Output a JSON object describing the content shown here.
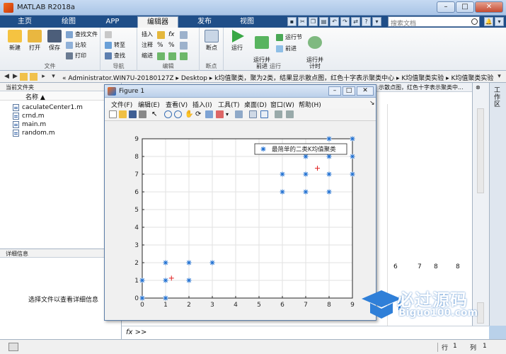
{
  "window": {
    "title": "MATLAB R2018a"
  },
  "tabs": [
    {
      "label": "主页",
      "active": false
    },
    {
      "label": "绘图",
      "active": false
    },
    {
      "label": "APP",
      "active": false
    },
    {
      "label": "编辑器",
      "active": true
    },
    {
      "label": "发布",
      "active": false
    },
    {
      "label": "视图",
      "active": false
    }
  ],
  "search": {
    "placeholder": "搜索文档"
  },
  "ribbon": {
    "file_group": "文件",
    "nav_group": "导航",
    "edit_group": "编辑",
    "bp_group": "断点",
    "run_group": "运行",
    "new": "新建",
    "open": "打开",
    "save": "保存",
    "find_files": "查找文件",
    "compare": "比较",
    "print": "打印",
    "goto": "转至",
    "find": "查找",
    "insert": "插入",
    "comment": "注释",
    "indent": "缩进",
    "breakpoints": "断点",
    "run": "运行",
    "run_advance": "运行并\n前进",
    "run_section": "运行节",
    "advance": "前进",
    "run_time": "运行并\n计时"
  },
  "address": {
    "path": "« Administrator.WIN7U-20180127Z  ▸  Desktop  ▸  k均值聚类，聚为2类，结果显示散点图，红色十字表示聚类中心  ▸  K均值聚类实验  ▸  K均值聚类实验"
  },
  "current_folder": {
    "header": "当前文件夹",
    "col_name": "名称 ▲",
    "files": [
      "caculateCenter1.m",
      "crnd.m",
      "main.m",
      "random.m"
    ]
  },
  "details": {
    "header": "详细信息",
    "hint": "选择文件以查看详细信息"
  },
  "editor": {
    "partial_title": "示散点图，红色十字表示聚类中...",
    "bg_numbers": [
      "6",
      "7",
      "8",
      "8",
      "9"
    ]
  },
  "workspace_label": "工作区",
  "cmd": {
    "prompt": "fx >>"
  },
  "status": {
    "row_label": "行",
    "row": "1",
    "col_label": "列",
    "col": "1"
  },
  "figure": {
    "title": "Figure 1",
    "menu": [
      "文件(F)",
      "编辑(E)",
      "查看(V)",
      "插入(I)",
      "工具(T)",
      "桌面(D)",
      "窗口(W)",
      "帮助(H)"
    ]
  },
  "chart_data": {
    "type": "scatter",
    "title": "",
    "xlabel": "",
    "ylabel": "",
    "xlim": [
      0,
      9
    ],
    "ylim": [
      0,
      9
    ],
    "xticks": [
      0,
      1,
      2,
      3,
      4,
      5,
      6,
      7,
      8,
      9
    ],
    "yticks": [
      0,
      1,
      2,
      3,
      4,
      5,
      6,
      7,
      8,
      9
    ],
    "grid": true,
    "legend": {
      "entries": [
        "最简单的二类K均值聚类"
      ],
      "placement": "top-right"
    },
    "series": [
      {
        "name": "最简单的二类K均值聚类",
        "marker": "*",
        "color": "#1f6fd1",
        "points": [
          [
            0,
            0
          ],
          [
            0,
            1
          ],
          [
            1,
            0
          ],
          [
            1,
            1
          ],
          [
            1,
            2
          ],
          [
            2,
            1
          ],
          [
            2,
            2
          ],
          [
            3,
            2
          ],
          [
            6,
            6
          ],
          [
            6,
            7
          ],
          [
            7,
            6
          ],
          [
            7,
            7
          ],
          [
            7,
            8
          ],
          [
            8,
            6
          ],
          [
            8,
            7
          ],
          [
            8,
            8
          ],
          [
            8,
            9
          ],
          [
            9,
            7
          ],
          [
            9,
            8
          ],
          [
            9,
            9
          ]
        ]
      },
      {
        "name": "",
        "marker": "+",
        "color": "#e02020",
        "points": [
          [
            1.25,
            1.125
          ],
          [
            7.5,
            7.333
          ]
        ]
      }
    ]
  },
  "watermark": {
    "text": "必过源码",
    "sub": "Biguo100.com"
  }
}
